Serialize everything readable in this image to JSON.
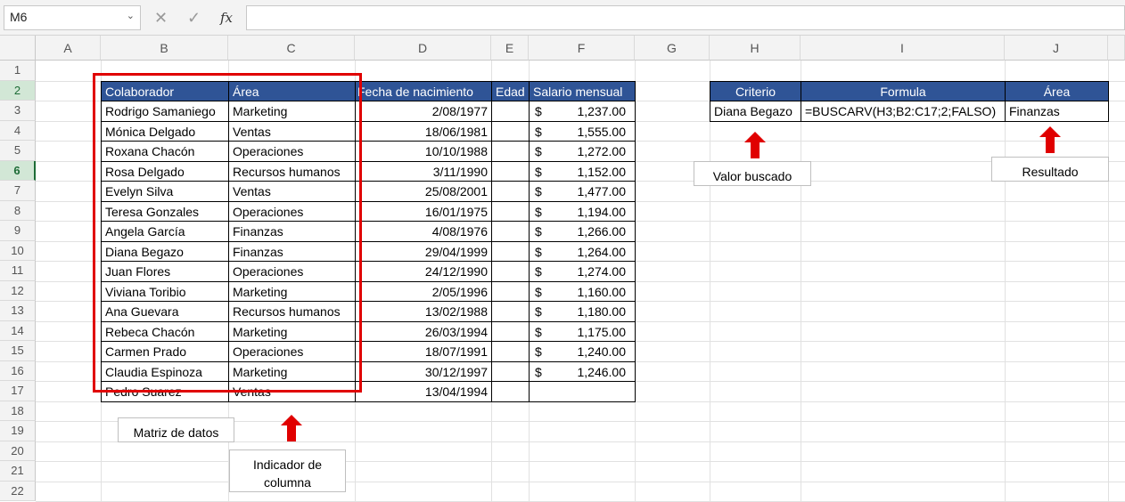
{
  "formula_bar": {
    "cell_ref": "M6",
    "fx": "fx",
    "cancel": "✕",
    "enter": "✓",
    "formula": ""
  },
  "columns": [
    "A",
    "B",
    "C",
    "D",
    "E",
    "F",
    "G",
    "H",
    "I",
    "J"
  ],
  "rows": [
    "1",
    "2",
    "3",
    "4",
    "5",
    "6",
    "7",
    "8",
    "9",
    "10",
    "11",
    "12",
    "13",
    "14",
    "15",
    "16",
    "17",
    "18",
    "19",
    "20",
    "21",
    "22"
  ],
  "table": {
    "headers": [
      "Colaborador",
      "Área",
      "Fecha de nacimiento",
      "Edad",
      "Salario mensual"
    ],
    "currency_symbol": "$",
    "rows": [
      {
        "name": "Rodrigo Samaniego",
        "area": "Marketing",
        "date": "2/08/1977",
        "salary": "1,237.00"
      },
      {
        "name": "Mónica Delgado",
        "area": "Ventas",
        "date": "18/06/1981",
        "salary": "1,555.00"
      },
      {
        "name": "Roxana Chacón",
        "area": "Operaciones",
        "date": "10/10/1988",
        "salary": "1,272.00"
      },
      {
        "name": "Rosa Delgado",
        "area": "Recursos humanos",
        "date": "3/11/1990",
        "salary": "1,152.00"
      },
      {
        "name": "Evelyn Silva",
        "area": "Ventas",
        "date": "25/08/2001",
        "salary": "1,477.00"
      },
      {
        "name": "Teresa Gonzales",
        "area": "Operaciones",
        "date": "16/01/1975",
        "salary": "1,194.00"
      },
      {
        "name": "Angela García",
        "area": "Finanzas",
        "date": "4/08/1976",
        "salary": "1,266.00"
      },
      {
        "name": "Diana Begazo",
        "area": "Finanzas",
        "date": "29/04/1999",
        "salary": "1,264.00"
      },
      {
        "name": "Juan Flores",
        "area": "Operaciones",
        "date": "24/12/1990",
        "salary": "1,274.00"
      },
      {
        "name": "Viviana Toribio",
        "area": "Marketing",
        "date": "2/05/1996",
        "salary": "1,160.00"
      },
      {
        "name": "Ana Guevara",
        "area": "Recursos humanos",
        "date": "13/02/1988",
        "salary": "1,180.00"
      },
      {
        "name": "Rebeca Chacón",
        "area": "Marketing",
        "date": "26/03/1994",
        "salary": "1,175.00"
      },
      {
        "name": "Carmen Prado",
        "area": "Operaciones",
        "date": "18/07/1991",
        "salary": "1,240.00"
      },
      {
        "name": "Claudia Espinoza",
        "area": "Marketing",
        "date": "30/12/1997",
        "salary": "1,246.00"
      },
      {
        "name": "Pedro Suarez",
        "area": "Ventas",
        "date": "13/04/1994",
        "salary": ""
      }
    ]
  },
  "lookup": {
    "headers": [
      "Criterio",
      "Formula",
      "Área"
    ],
    "criterio": "Diana Begazo",
    "formula": "=BUSCARV(H3;B2:C17;2;FALSO)",
    "result": "Finanzas"
  },
  "callouts": {
    "valor_buscado": "Valor buscado",
    "resultado": "Resultado",
    "matriz": "Matriz de datos",
    "indicador_1": "Indicador de",
    "indicador_2": "columna"
  },
  "colors": {
    "header_blue": "#2f5496",
    "highlight_red": "#e00000",
    "active_row": "#1e6c37"
  }
}
